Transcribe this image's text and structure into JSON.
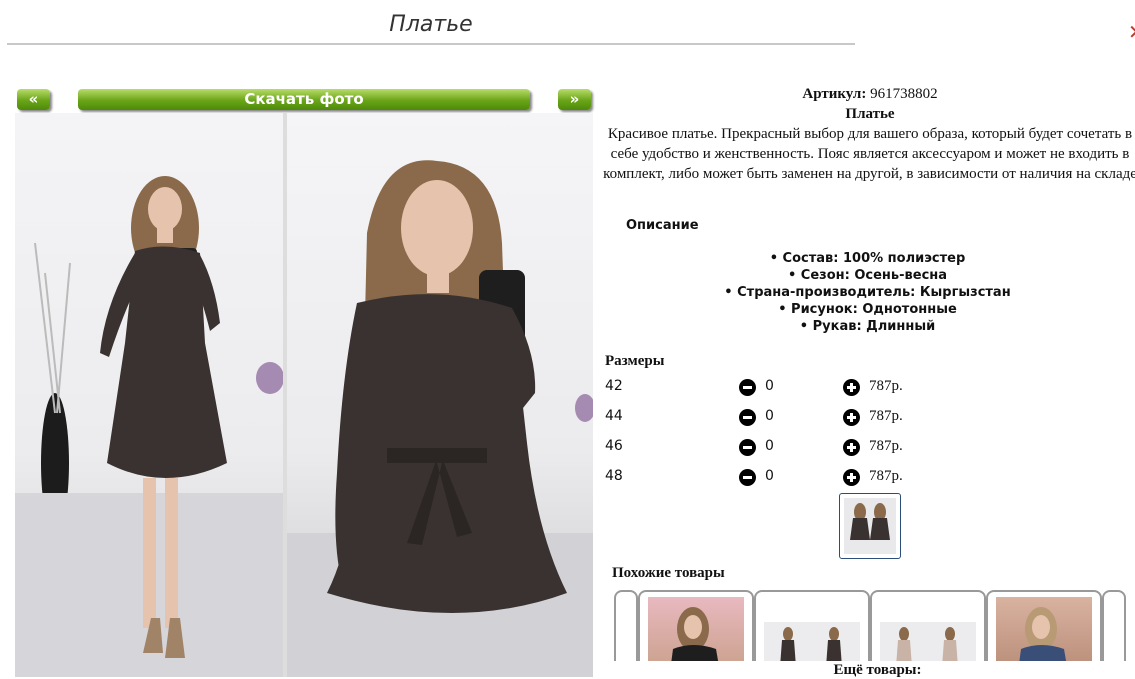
{
  "header": {
    "title": "Платье",
    "close_label": "✕"
  },
  "gallery": {
    "prev_label": "«",
    "download_label": "Скачать фото",
    "next_label": "»"
  },
  "product": {
    "article_label": "Артикул:",
    "article_value": "961738802",
    "name": "Платье",
    "description": "Красивое платье. Прекрасный выбор для вашего образа, который будет сочетать в себе удобство и женственность. Пояс является аксессуаром и может не входить в комплект, либо может быть заменен на другой, в зависимости от наличия на складе",
    "specs_heading": "Описание",
    "specs": [
      "• Состав: 100% полиэстер",
      "• Сезон: Осень-весна",
      "• Страна-производитель: Кыргызстан",
      "• Рисунок: Однотонные",
      "• Рукав: Длинный"
    ]
  },
  "sizes": {
    "heading": "Размеры",
    "rows": [
      {
        "size": "42",
        "qty": "0",
        "price": "787р."
      },
      {
        "size": "44",
        "qty": "0",
        "price": "787р."
      },
      {
        "size": "46",
        "qty": "0",
        "price": "787р."
      },
      {
        "size": "48",
        "qty": "0",
        "price": "787р."
      }
    ]
  },
  "similar": {
    "heading": "Похожие товары",
    "more_label": "Ещё товары:"
  },
  "colors": {
    "accent_green": "#6aa518",
    "dress": "#3a3230",
    "hair": "#8a6a4a",
    "skin": "#e6c3ad"
  }
}
